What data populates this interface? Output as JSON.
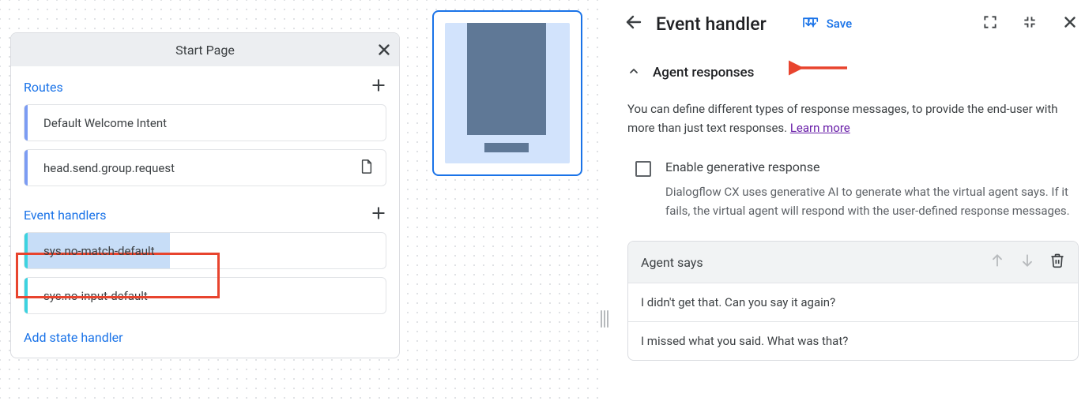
{
  "page_card": {
    "title": "Start Page",
    "routes_label": "Routes",
    "routes": [
      {
        "label": "Default Welcome Intent"
      },
      {
        "label": "head.send.group.request"
      }
    ],
    "event_handlers_label": "Event handlers",
    "event_handlers": [
      {
        "label": "sys.no-match-default"
      },
      {
        "label": "sys.no-input-default"
      }
    ],
    "add_state_label": "Add state handler"
  },
  "panel": {
    "title": "Event handler",
    "save_label": "Save",
    "accordion_label": "Agent responses",
    "description_pre": "You can define different types of response messages, to provide the end-user with more than just text responses. ",
    "learn_more": "Learn more",
    "check_label": "Enable generative response",
    "check_desc": "Dialogflow CX uses generative AI to generate what the virtual agent says. If it fails, the virtual agent will respond with the user-defined response messages.",
    "agent_says_label": "Agent says",
    "responses": [
      "I didn't get that. Can you say it again?",
      "I missed what you said. What was that?"
    ]
  }
}
